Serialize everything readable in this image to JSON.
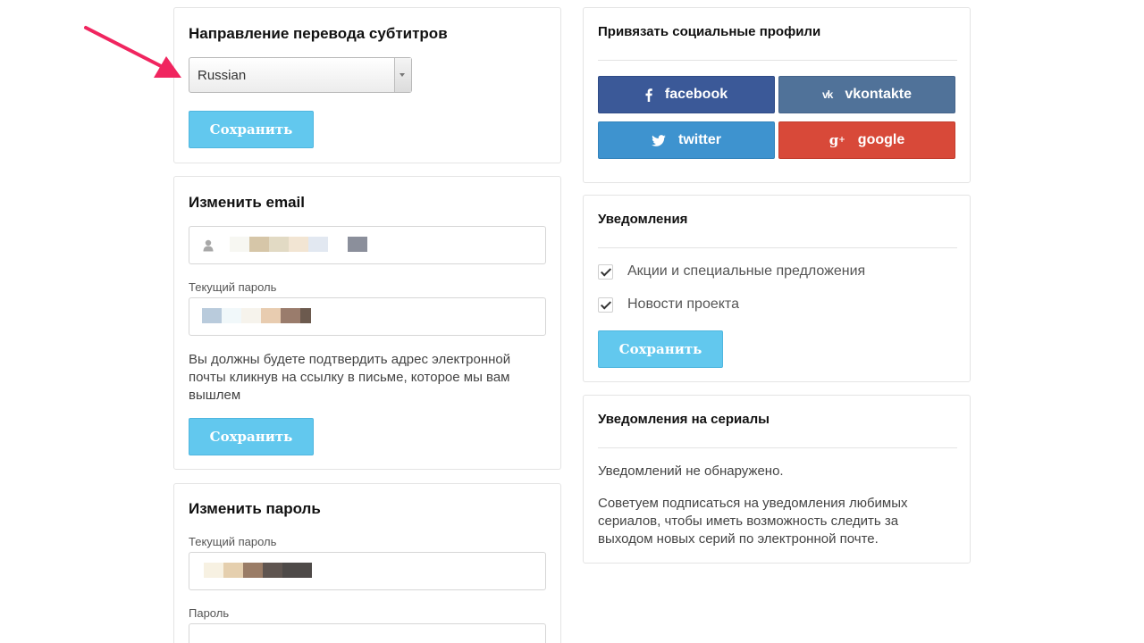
{
  "subtitles": {
    "title": "Направление перевода субтитров",
    "selected_language": "Russian",
    "save_label": "Сохранить"
  },
  "change_email": {
    "title": "Изменить email",
    "current_password_label": "Текущий пароль",
    "note": "Вы должны будете подтвердить адрес электронной почты кликнув на ссылку в письме, которое мы вам вышлем",
    "save_label": "Сохранить"
  },
  "change_password": {
    "title": "Изменить пароль",
    "current_password_label": "Текущий пароль",
    "password_label": "Пароль"
  },
  "social": {
    "title": "Привязать социальные профили",
    "buttons": [
      {
        "label": "facebook",
        "icon": "facebook-icon",
        "color": "#3b5998"
      },
      {
        "label": "vkontakte",
        "icon": "vk-icon",
        "color": "#507299"
      },
      {
        "label": "twitter",
        "icon": "twitter-icon",
        "color": "#3e93cf"
      },
      {
        "label": "google",
        "icon": "google-plus-icon",
        "color": "#d84939"
      }
    ]
  },
  "notifications": {
    "title": "Уведомления",
    "options": [
      {
        "label": "Акции и специальные предложения",
        "checked": true
      },
      {
        "label": "Новости проекта",
        "checked": true
      }
    ],
    "save_label": "Сохранить"
  },
  "series_notifications": {
    "title": "Уведомления на сериалы",
    "empty_text": "Уведомлений не обнаружено.",
    "advice": "Советуем подписаться на уведомления любимых сериалов, чтобы иметь возможность следить за выходом новых серий по электронной почте."
  },
  "colors": {
    "accent_button": "#62c8ee",
    "annotation_arrow": "#f0255f"
  }
}
